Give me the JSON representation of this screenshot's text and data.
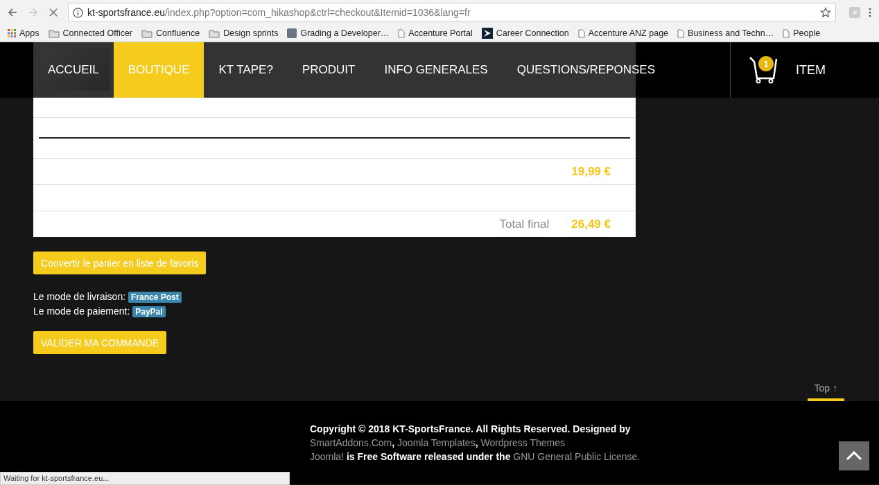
{
  "browser": {
    "url_host": "kt-sportsfrance.eu",
    "url_path": "/index.php?option=com_hikashop&ctrl=checkout&Itemid=1036&lang=fr",
    "bookmarks": [
      {
        "kind": "apps",
        "label": "Apps"
      },
      {
        "kind": "folder",
        "label": "Connected Officer"
      },
      {
        "kind": "folder",
        "label": "Confluence"
      },
      {
        "kind": "folder",
        "label": "Design sprints"
      },
      {
        "kind": "photo",
        "label": "Grading a Developer…"
      },
      {
        "kind": "page",
        "label": "Accenture Portal"
      },
      {
        "kind": "brand",
        "label": "Career Connection"
      },
      {
        "kind": "page",
        "label": "Accenture ANZ page"
      },
      {
        "kind": "page",
        "label": "Business and Techn…"
      },
      {
        "kind": "page",
        "label": "People"
      }
    ],
    "status_text": "Waiting for kt-sportsfrance.eu..."
  },
  "nav": {
    "items": [
      {
        "label": "ACCUEIL",
        "selected": false
      },
      {
        "label": "BOUTIQUE",
        "selected": true
      },
      {
        "label": "KT TAPE?",
        "selected": false
      },
      {
        "label": "PRODUIT",
        "selected": false
      },
      {
        "label": "INFO GENERALES",
        "selected": false
      },
      {
        "label": "QUESTIONS/REPONSES",
        "selected": false
      }
    ],
    "cart": {
      "count": "1",
      "label": "ITEM"
    }
  },
  "summary": {
    "rows": [
      {
        "kind": "rule"
      },
      {
        "kind": "price",
        "value": "19,99 €"
      },
      {
        "kind": "blank"
      },
      {
        "kind": "total",
        "label": "Total final",
        "value": "26,49 €"
      }
    ]
  },
  "wishlist_button": "Convertir le panier en liste de favoris",
  "shipping": {
    "label": "Le mode de livraison:",
    "value": "France Post"
  },
  "payment": {
    "label": "Le mode de paiement:",
    "value": "PayPal"
  },
  "validate_button": "VALIDER MA COMMANDE",
  "top_link": "Top ↑",
  "footer": {
    "lines": [
      [
        {
          "kind": "text",
          "text": "Copyright © 2018 KT-SportsFrance. All Rights Reserved. Designed by"
        }
      ],
      [
        {
          "kind": "link",
          "text": "SmartAddons.Com"
        },
        {
          "kind": "text",
          "text": ", "
        },
        {
          "kind": "link",
          "text": "Joomla Templates"
        },
        {
          "kind": "text",
          "text": ", "
        },
        {
          "kind": "link",
          "text": "Wordpress Themes"
        }
      ],
      [
        {
          "kind": "link",
          "text": "Joomla!"
        },
        {
          "kind": "text",
          "text": " is Free Software released under the "
        },
        {
          "kind": "link",
          "text": "GNU General Public License."
        }
      ]
    ]
  }
}
